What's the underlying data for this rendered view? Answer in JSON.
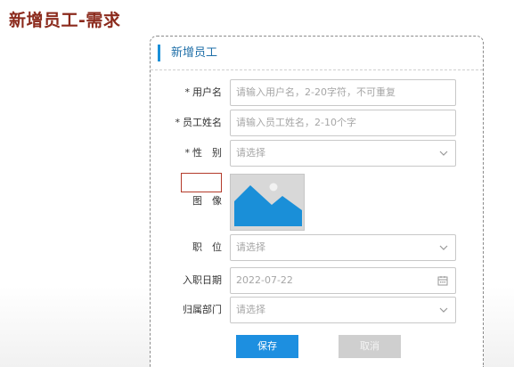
{
  "slide": {
    "title": "新增员工-需求"
  },
  "form": {
    "header": "新增员工",
    "required_mark": "*",
    "username": {
      "label": "用户名",
      "placeholder": "请输入用户名，2-20字符，不可重复"
    },
    "name": {
      "label": "员工姓名",
      "placeholder": "请输入员工姓名，2-10个字"
    },
    "gender": {
      "label": "性　别",
      "placeholder": "请选择"
    },
    "avatar": {
      "label": "图　像"
    },
    "position": {
      "label": "职　位",
      "placeholder": "请选择"
    },
    "hire_date": {
      "label": "入职日期",
      "value": "2022-07-22"
    },
    "department": {
      "label": "归属部门",
      "placeholder": "请选择"
    },
    "buttons": {
      "save": "保存",
      "cancel": "取消"
    }
  },
  "colors": {
    "accent": "#1d8fe0",
    "title": "#8b2a1c",
    "annotation": "#b33a2a"
  },
  "icons": [
    "chevron-down-icon",
    "calendar-icon",
    "image-placeholder-icon"
  ]
}
